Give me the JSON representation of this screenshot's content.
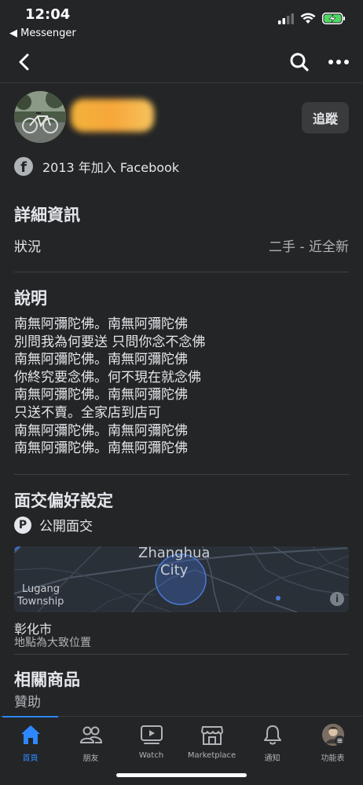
{
  "status_bar": {
    "time": "12:04",
    "back_app": "◀ Messenger"
  },
  "seller": {
    "follow_label": "追蹤",
    "joined_text": "2013 年加入 Facebook",
    "fb_icon_glyph": "f"
  },
  "details": {
    "title": "詳細資訊",
    "condition_label": "狀況",
    "condition_value": "二手 - 近全新"
  },
  "description": {
    "title": "說明",
    "lines": [
      "南無阿彌陀佛。南無阿彌陀佛",
      "別問我為何要送 只問你念不念佛",
      "南無阿彌陀佛。南無阿彌陀佛",
      "你終究要念佛。何不現在就念佛",
      "南無阿彌陀佛。南無阿彌陀佛",
      "只送不賣。全家店到店可",
      "南無阿彌陀佛。南無阿彌陀佛",
      "南無阿彌陀佛。南無阿彌陀佛"
    ]
  },
  "meetup": {
    "title": "面交偏好設定",
    "icon_glyph": "P",
    "option": "公開面交"
  },
  "map": {
    "city_line1": "Zhanghua",
    "city_line2": "City",
    "area_line1": "Lugang",
    "area_line2": "Township",
    "info_glyph": "i"
  },
  "location": {
    "name": "彰化市",
    "note": "地點為大致位置"
  },
  "related": {
    "title": "相關商品",
    "subtitle": "贊助"
  },
  "tabs": [
    {
      "label": "首頁",
      "icon": "home-icon"
    },
    {
      "label": "朋友",
      "icon": "friends-icon"
    },
    {
      "label": "Watch",
      "icon": "watch-icon"
    },
    {
      "label": "Marketplace",
      "icon": "marketplace-icon"
    },
    {
      "label": "通知",
      "icon": "bell-icon"
    },
    {
      "label": "功能表",
      "icon": "menu-avatar-icon"
    }
  ],
  "colors": {
    "background": "#242526",
    "accent": "#2d88ff",
    "text": "#e4e6eb",
    "secondary_text": "#b0b3b8"
  }
}
